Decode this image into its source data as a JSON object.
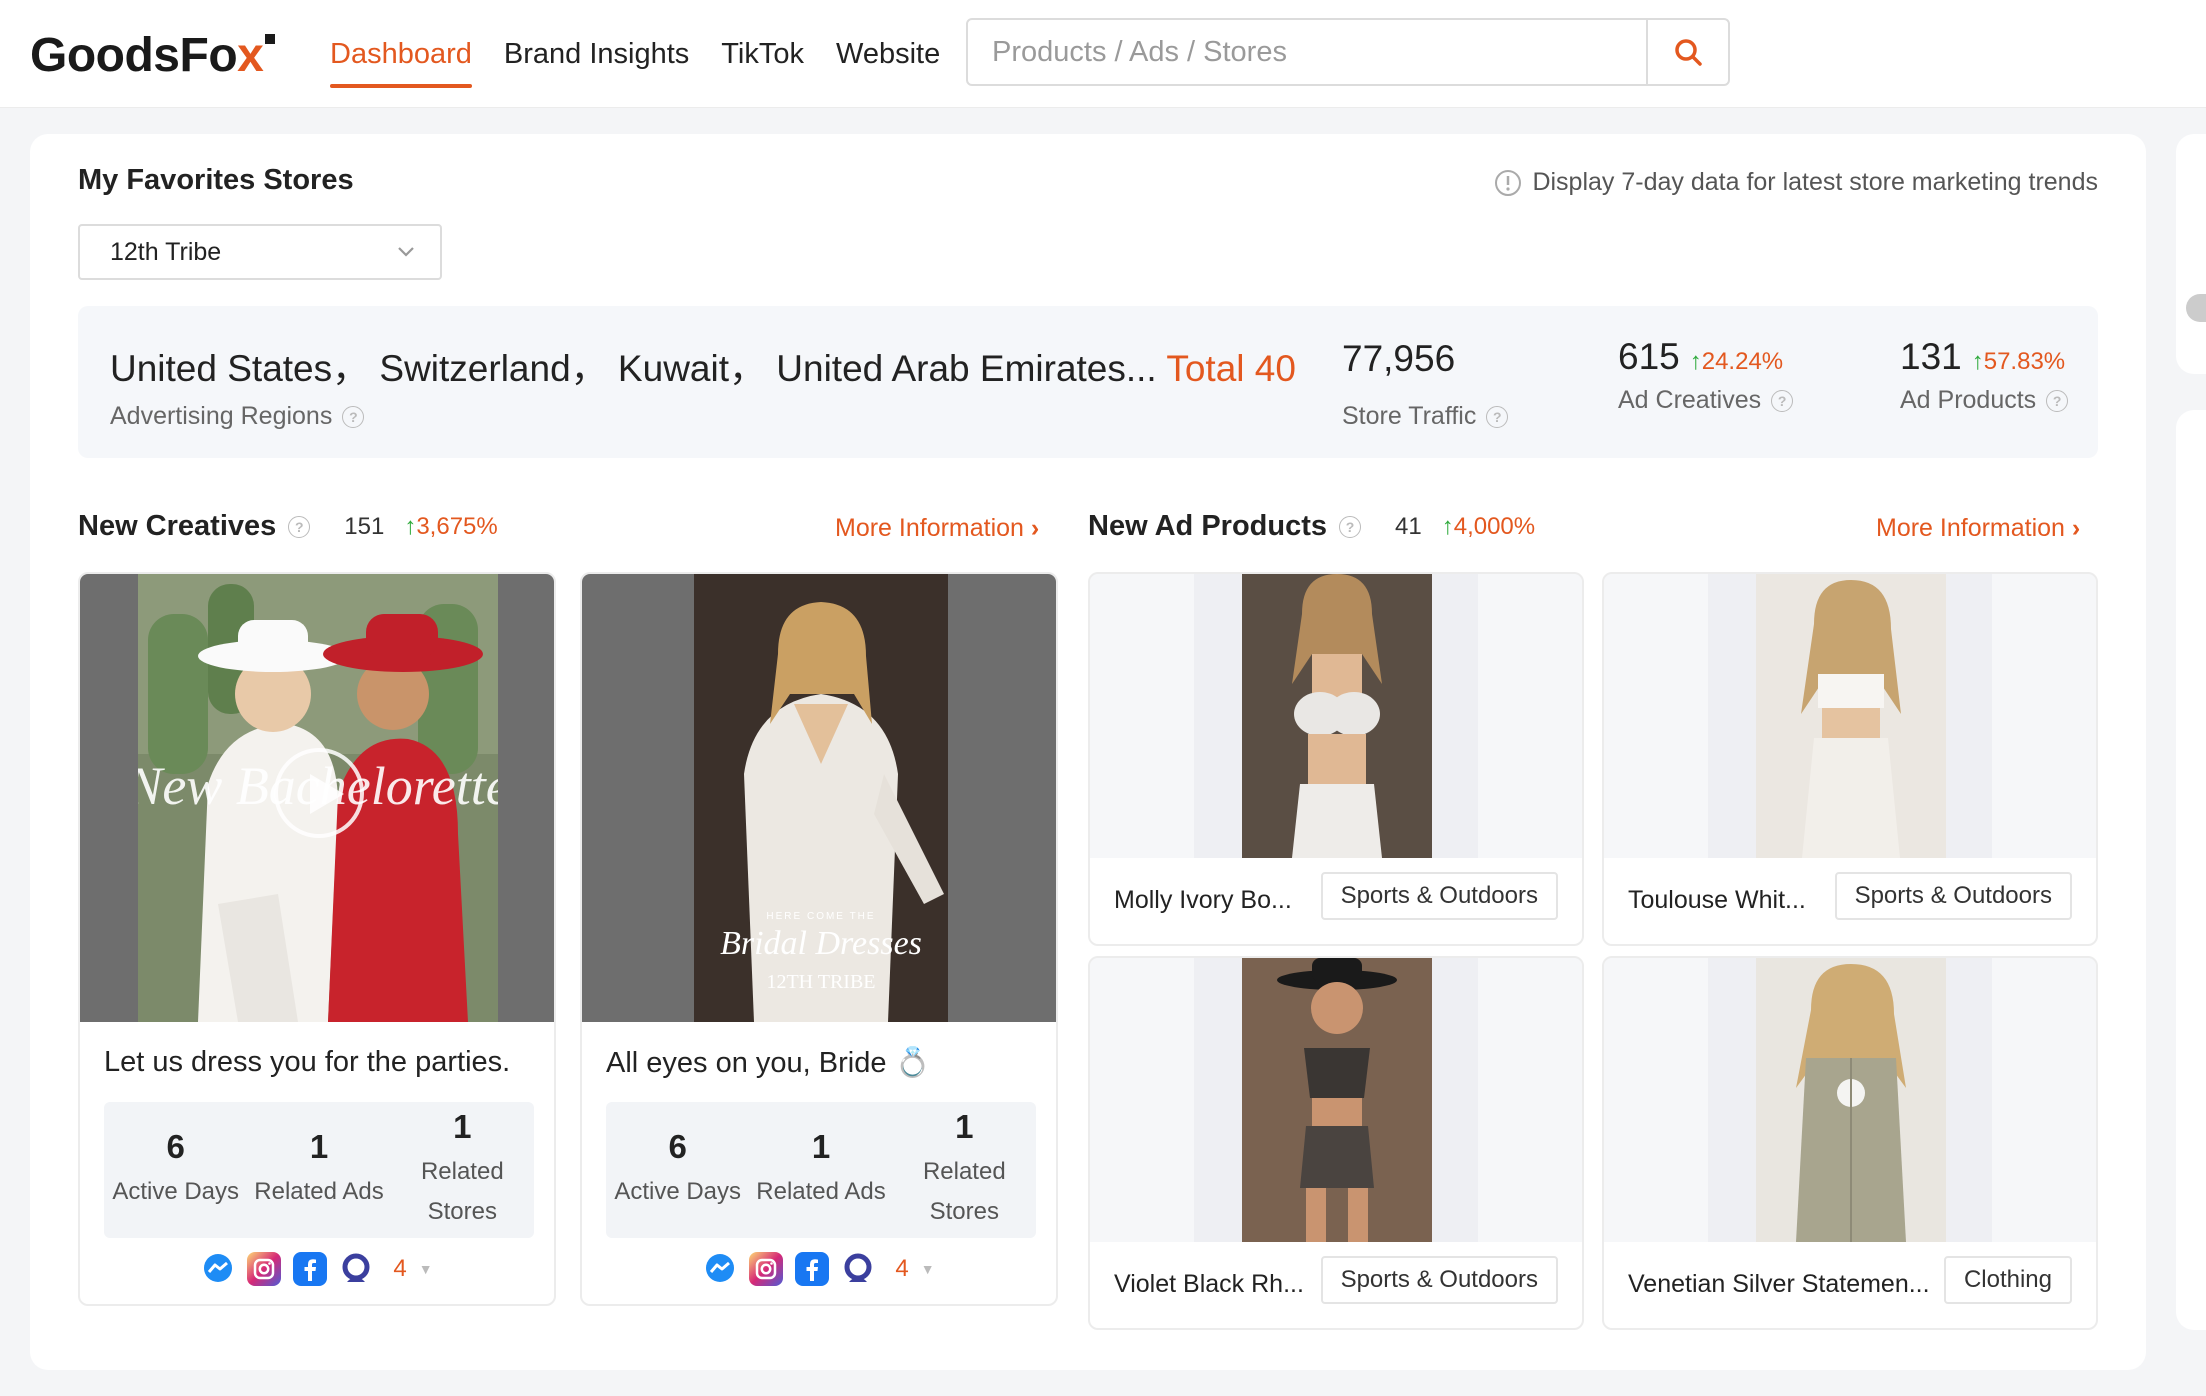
{
  "header": {
    "logo": {
      "text_main": "GoodsFo",
      "text_accent": "x"
    },
    "nav": [
      {
        "label": "Dashboard",
        "active": true
      },
      {
        "label": "Brand Insights",
        "active": false
      },
      {
        "label": "TikTok",
        "active": false
      },
      {
        "label": "Website",
        "active": false
      }
    ],
    "search": {
      "placeholder": "Products / Ads / Stores",
      "value": "",
      "icon": "search-icon"
    }
  },
  "favorites": {
    "title": "My Favorites Stores",
    "hint": "Display 7-day data for latest store marketing trends",
    "selected_store": "12th Tribe",
    "regions": {
      "list": "United States，  Switzerland，  Kuwait，  United Arab Emirates...",
      "total": "Total 40",
      "label": "Advertising Regions"
    },
    "store_traffic": {
      "value": "77,956",
      "label": "Store Traffic"
    },
    "ad_creatives": {
      "value": "615",
      "growth": "24.24%",
      "label": "Ad Creatives"
    },
    "ad_products": {
      "value": "131",
      "growth": "57.83%",
      "label": "Ad Products"
    }
  },
  "new_creatives": {
    "title": "New Creatives",
    "count": "151",
    "growth": "3,675%",
    "more": "More Information",
    "items": [
      {
        "title": "Let us dress you for the parties.",
        "active_days": "6",
        "active_days_label": "Active Days",
        "related_ads": "1",
        "related_ads_label": "Related Ads",
        "related_stores": "1",
        "related_stores_label": "Related Stores",
        "platform_count": "4",
        "overlay_text": "New Bachelorette"
      },
      {
        "title": "All eyes on you, Bride 💍",
        "active_days": "6",
        "active_days_label": "Active Days",
        "related_ads": "1",
        "related_ads_label": "Related Ads",
        "related_stores": "1",
        "related_stores_label": "Related Stores",
        "platform_count": "4",
        "overlay_small": "HERE COME THE",
        "overlay_text": "Bridal Dresses",
        "overlay_brand": "12TH TRIBE"
      }
    ],
    "platforms": [
      "messenger-icon",
      "instagram-icon",
      "facebook-icon",
      "audience-network-icon"
    ]
  },
  "new_ad_products": {
    "title": "New Ad Products",
    "count": "41",
    "growth": "4,000%",
    "more": "More Information",
    "items": [
      {
        "name": "Molly Ivory Bo...",
        "category": "Sports & Outdoors"
      },
      {
        "name": "Toulouse Whit...",
        "category": "Sports & Outdoors"
      },
      {
        "name": "Violet Black Rh...",
        "category": "Sports & Outdoors"
      },
      {
        "name": "Venetian Silver Statemen...",
        "category": "Clothing"
      }
    ]
  },
  "colors": {
    "accent": "#e3581f",
    "up": "#2faa3c",
    "panel_bg": "#f5f7fa"
  }
}
